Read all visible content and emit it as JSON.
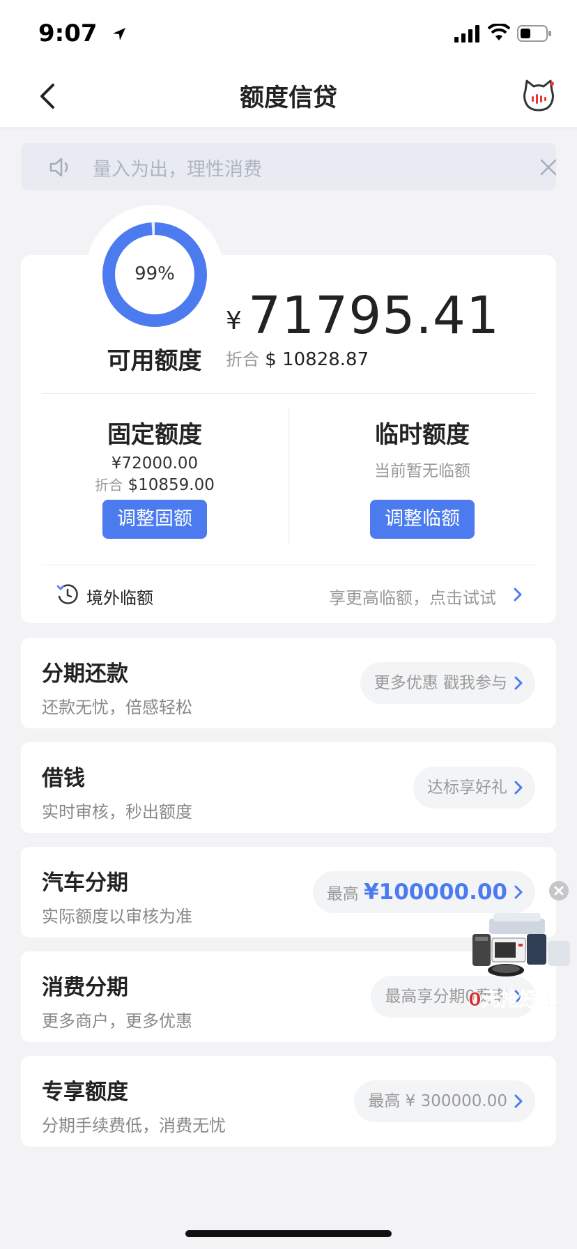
{
  "status_bar": {
    "time": "9:07"
  },
  "nav": {
    "title": "额度信贷"
  },
  "notice": {
    "text": "量入为出，理性消费"
  },
  "credit": {
    "usage_label": "99%",
    "usage_fraction": 0.99,
    "available_label": "可用额度",
    "currency": "¥",
    "amount": "71795.41",
    "converted_prefix": "折合",
    "converted_value": "$ 10828.87"
  },
  "fixed": {
    "title": "固定额度",
    "amount": "¥72000.00",
    "converted_prefix": "折合",
    "converted_value": "$10859.00",
    "button": "调整固额"
  },
  "temporary": {
    "title": "临时额度",
    "status": "当前暂无临额",
    "button": "调整临额"
  },
  "abroad": {
    "label": "境外临额",
    "hint": "享更高临额，点击试试"
  },
  "items": [
    {
      "title": "分期还款",
      "subtitle": "还款无忧，倍感轻松",
      "pill_text": "更多优惠 戳我参与"
    },
    {
      "title": "借钱",
      "subtitle": "实时审核，秒出额度",
      "pill_text": "达标享好礼"
    },
    {
      "title": "汽车分期",
      "subtitle": "实际额度以审核为准",
      "pill_prefix": "最高",
      "pill_highlight": "¥100000.00"
    },
    {
      "title": "消费分期",
      "subtitle": "更多商户，更多优惠",
      "pill_text": "最高享分期0费率"
    },
    {
      "title": "专享额度",
      "subtitle": "分期手续费低，消费无忧",
      "pill_text": "最高 ¥ 300000.00"
    }
  ],
  "ad": {
    "text": "0元抢好礼"
  },
  "colors": {
    "accent": "#4c7bef",
    "ad_red": "#d42b2b",
    "background": "#f3f3f5"
  }
}
